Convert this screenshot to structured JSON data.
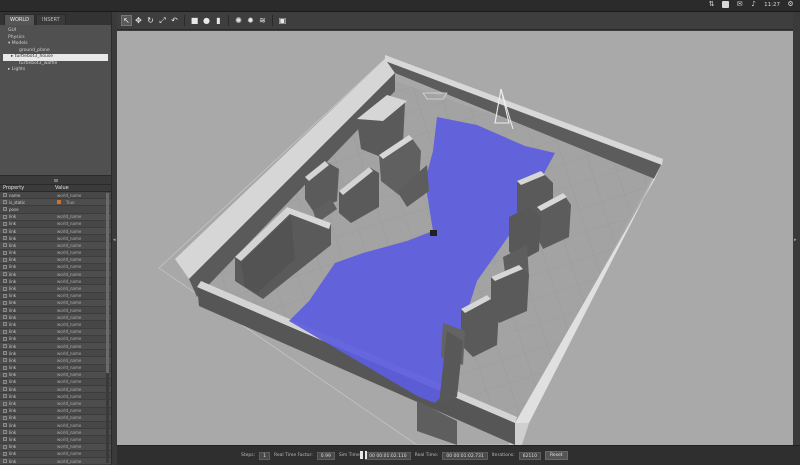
{
  "left_panel": {
    "tabs": [
      {
        "label": "WORLD"
      },
      {
        "label": "INSERT"
      }
    ],
    "tree": [
      {
        "label": "GUI",
        "level": 0
      },
      {
        "label": "Physics",
        "level": 0
      },
      {
        "label": "Models",
        "level": 0
      },
      {
        "label": "ground_plane",
        "level": 1
      },
      {
        "label": "turtlebot3_house",
        "level": 1
      },
      {
        "label": "turtlebot3_waffle",
        "level": 1
      },
      {
        "label": "Lights",
        "level": 0
      }
    ],
    "property_header": {
      "property": "Property",
      "value": "Value"
    },
    "properties": [
      {
        "name": "name",
        "value": "world_name"
      },
      {
        "name": "is_static",
        "value": "True"
      },
      {
        "name": "pose",
        "value": ""
      },
      {
        "name": "link",
        "value": "world_name"
      },
      {
        "name": "link",
        "value": "world_name"
      },
      {
        "name": "link",
        "value": "world_name"
      },
      {
        "name": "link",
        "value": "world_name"
      },
      {
        "name": "link",
        "value": "world_name"
      },
      {
        "name": "link",
        "value": "world_name"
      },
      {
        "name": "link",
        "value": "world_name"
      },
      {
        "name": "link",
        "value": "world_name"
      },
      {
        "name": "link",
        "value": "world_name"
      },
      {
        "name": "link",
        "value": "world_name"
      },
      {
        "name": "link",
        "value": "world_name"
      },
      {
        "name": "link",
        "value": "world_name"
      },
      {
        "name": "link",
        "value": "world_name"
      },
      {
        "name": "link",
        "value": "world_name"
      },
      {
        "name": "link",
        "value": "world_name"
      },
      {
        "name": "link",
        "value": "world_name"
      },
      {
        "name": "link",
        "value": "world_name"
      },
      {
        "name": "link",
        "value": "world_name"
      },
      {
        "name": "link",
        "value": "world_name"
      },
      {
        "name": "link",
        "value": "world_name"
      },
      {
        "name": "link",
        "value": "world_name"
      },
      {
        "name": "link",
        "value": "world_name"
      },
      {
        "name": "link",
        "value": "world_name"
      },
      {
        "name": "link",
        "value": "world_name"
      },
      {
        "name": "link",
        "value": "world_name"
      },
      {
        "name": "link",
        "value": "world_name"
      },
      {
        "name": "link",
        "value": "world_name"
      },
      {
        "name": "link",
        "value": "world_name"
      },
      {
        "name": "link",
        "value": "world_name"
      },
      {
        "name": "link",
        "value": "world_name"
      },
      {
        "name": "link",
        "value": "world_name"
      },
      {
        "name": "link",
        "value": "world_name"
      },
      {
        "name": "link",
        "value": "world_name"
      },
      {
        "name": "link",
        "value": "world_name"
      },
      {
        "name": "link",
        "value": "world_name"
      }
    ]
  },
  "system_bar": {
    "clock": "11:27"
  },
  "bottom_bar": {
    "steps_label": "Steps:",
    "steps_value": "1",
    "rtf_label": "Real Time Factor:",
    "rtf_value": "0.99",
    "sim_time_label": "Sim Time:",
    "sim_time_value": "00 00:01:02.110",
    "real_time_label": "Real Time:",
    "real_time_value": "00 00:01:02.731",
    "iterations_label": "Iterations:",
    "iterations_value": "62110",
    "reset_label": "Reset"
  },
  "colors": {
    "floor": "#9a9a9a",
    "wall_top": "#d9d9d9",
    "wall_side": "#5a5a5a",
    "laser": "#5a5ae0",
    "sky": "#a9a9a9"
  },
  "icons": {
    "toolbar": [
      "select-arrow-icon",
      "translate-icon",
      "rotate-icon",
      "scale-icon",
      "undo-icon",
      "box-icon",
      "sphere-icon",
      "cylinder-icon",
      "point-light-icon",
      "spot-light-icon",
      "directional-light-icon",
      "screenshot-icon"
    ]
  }
}
